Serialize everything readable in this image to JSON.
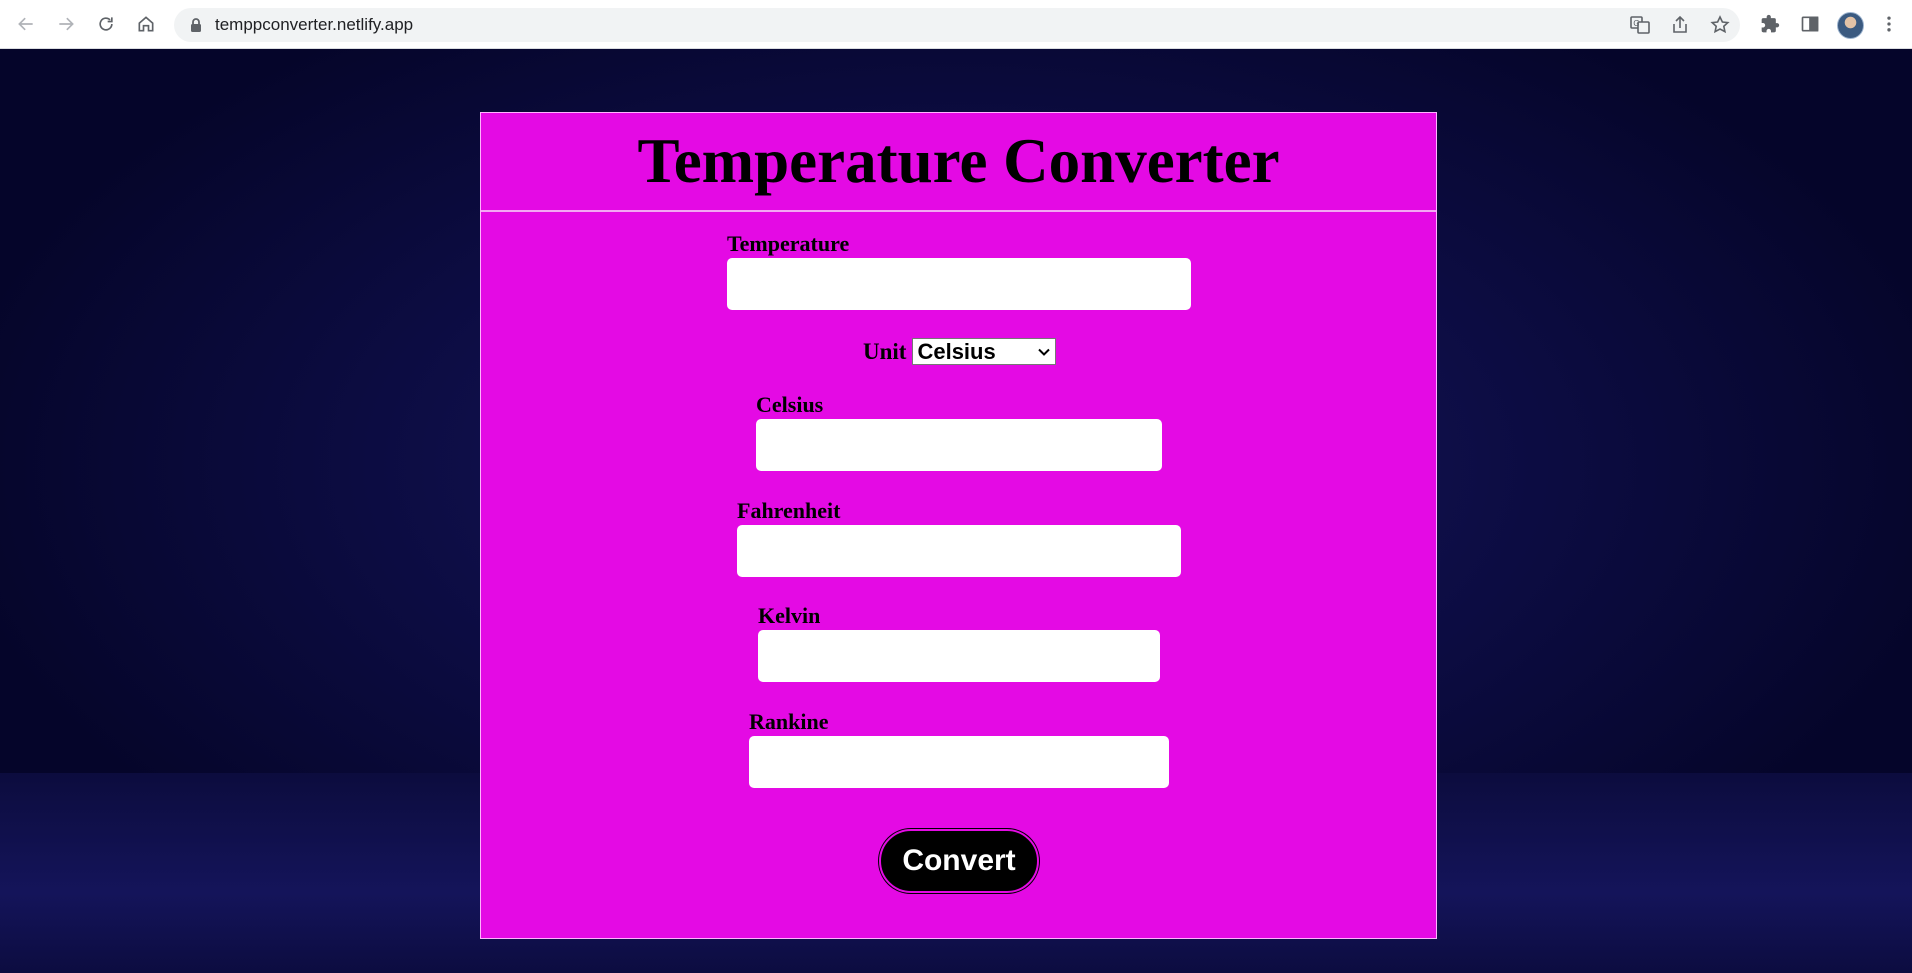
{
  "browser": {
    "url": "temppconverter.netlify.app"
  },
  "page": {
    "title": "Temperature Converter",
    "temperature": {
      "label": "Temperature",
      "value": ""
    },
    "unit": {
      "label": "Unit",
      "selected": "Celsius"
    },
    "celsius": {
      "label": "Celsius",
      "value": ""
    },
    "fahrenheit": {
      "label": "Fahrenheit",
      "value": ""
    },
    "kelvin": {
      "label": "Kelvin",
      "value": ""
    },
    "rankine": {
      "label": "Rankine",
      "value": ""
    },
    "convert_label": "Convert"
  },
  "colors": {
    "card_background": "#e40ae4",
    "page_background": "#05052a",
    "button_background": "#000000"
  }
}
